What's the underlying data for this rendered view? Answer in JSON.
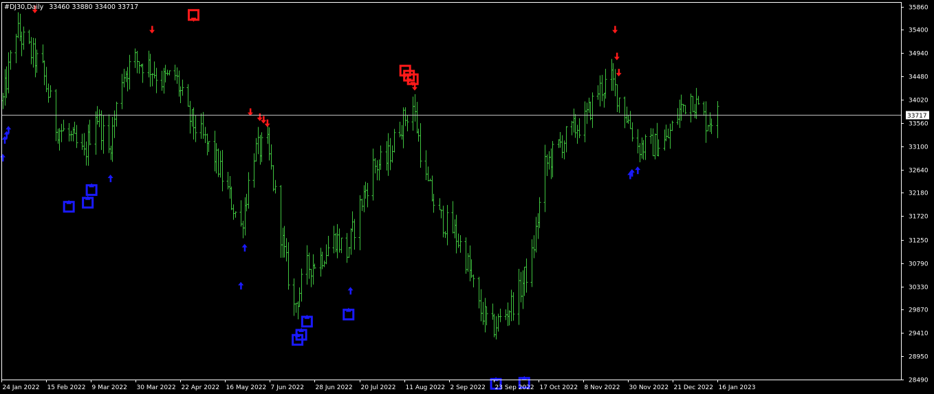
{
  "header": {
    "symbol": "#DJ30,Daily",
    "ohlc": "33460 33880 33400 33717"
  },
  "colors": {
    "background": "#000000",
    "axis": "#ffffff",
    "candle": "#3fc43f",
    "sell_marker": "#ff1a1a",
    "buy_marker": "#1a1aff",
    "price_line": "#c0c0c0"
  },
  "chart_data": {
    "type": "line",
    "title": "",
    "xlabel": "",
    "ylabel": "",
    "ylim": [
      28490,
      35950
    ],
    "y_ticks": [
      35860,
      35400,
      34940,
      34480,
      34020,
      33560,
      33100,
      32640,
      32180,
      31720,
      31250,
      30790,
      30330,
      29870,
      29410,
      28950,
      28490
    ],
    "x_tick_labels": [
      "24 Jan 2022",
      "15 Feb 2022",
      "9 Mar 2022",
      "30 Mar 2022",
      "22 Apr 2022",
      "16 May 2022",
      "7 Jun 2022",
      "28 Jun 2022",
      "20 Jul 2022",
      "11 Aug 2022",
      "2 Sep 2022",
      "23 Sep 2022",
      "17 Oct 2022",
      "8 Nov 2022",
      "30 Nov 2022",
      "21 Dec 2022",
      "16 Jan 2023"
    ],
    "current_price": 33717,
    "series": [
      {
        "name": "",
        "x": [
          "2022-01-10",
          "2022-01-17",
          "2022-01-24",
          "2022-01-31",
          "2022-02-07",
          "2022-02-14",
          "2022-02-22",
          "2022-02-28",
          "2022-03-07",
          "2022-03-14",
          "2022-03-21",
          "2022-03-28",
          "2022-04-04",
          "2022-04-11",
          "2022-04-18",
          "2022-04-25",
          "2022-05-02",
          "2022-05-09",
          "2022-05-16",
          "2022-05-23",
          "2022-05-30",
          "2022-06-06",
          "2022-06-13",
          "2022-06-20",
          "2022-06-27",
          "2022-07-05",
          "2022-07-11",
          "2022-07-18",
          "2022-07-25",
          "2022-08-01",
          "2022-08-08",
          "2022-08-15",
          "2022-08-22",
          "2022-08-29",
          "2022-09-06",
          "2022-09-12",
          "2022-09-19",
          "2022-09-26",
          "2022-10-03",
          "2022-10-10",
          "2022-10-17",
          "2022-10-24",
          "2022-10-31",
          "2022-11-07",
          "2022-11-14",
          "2022-11-21",
          "2022-11-28",
          "2022-12-05",
          "2022-12-12",
          "2022-12-19",
          "2022-12-27",
          "2023-01-03",
          "2023-01-09",
          "2023-01-17",
          "2023-01-23"
        ],
        "values": [
          34000,
          35400,
          35000,
          34600,
          33500,
          33300,
          32900,
          33800,
          33000,
          34500,
          34800,
          34700,
          34400,
          34500,
          33700,
          33300,
          32900,
          32200,
          31500,
          33000,
          33100,
          31400,
          29900,
          30700,
          30900,
          31300,
          31000,
          31900,
          32700,
          32800,
          33500,
          33900,
          32400,
          31700,
          31400,
          30900,
          29900,
          29500,
          29800,
          30200,
          30900,
          32700,
          33100,
          33400,
          33600,
          34200,
          34400,
          33800,
          33100,
          33100,
          33200,
          33800,
          34100,
          33600,
          33717
        ]
      }
    ],
    "sell_signals": [
      {
        "x": "2022-01-27",
        "value": 35730,
        "kind": "arrow"
      },
      {
        "x": "2022-03-30",
        "value": 35330,
        "kind": "arrow"
      },
      {
        "x": "2022-04-21",
        "value": 35600,
        "kind": "box"
      },
      {
        "x": "2022-05-21",
        "value": 33700,
        "kind": "arrow"
      },
      {
        "x": "2022-05-26",
        "value": 33600,
        "kind": "arrow"
      },
      {
        "x": "2022-05-28",
        "value": 33550,
        "kind": "arrow"
      },
      {
        "x": "2022-05-30",
        "value": 33480,
        "kind": "arrow"
      },
      {
        "x": "2022-08-11",
        "value": 34500,
        "kind": "box"
      },
      {
        "x": "2022-08-13",
        "value": 34400,
        "kind": "box"
      },
      {
        "x": "2022-08-15",
        "value": 34330,
        "kind": "box"
      },
      {
        "x": "2022-08-16",
        "value": 34200,
        "kind": "arrow"
      },
      {
        "x": "2022-11-30",
        "value": 35330,
        "kind": "arrow"
      },
      {
        "x": "2022-12-01",
        "value": 34800,
        "kind": "arrow"
      },
      {
        "x": "2022-12-02",
        "value": 34480,
        "kind": "arrow"
      }
    ],
    "buy_signals": [
      {
        "x": "2022-01-10",
        "value": 32950,
        "kind": "arrow"
      },
      {
        "x": "2022-01-11",
        "value": 33300,
        "kind": "arrow"
      },
      {
        "x": "2022-01-12",
        "value": 33400,
        "kind": "arrow"
      },
      {
        "x": "2022-01-13",
        "value": 33500,
        "kind": "arrow"
      },
      {
        "x": "2022-02-14",
        "value": 32000,
        "kind": "box"
      },
      {
        "x": "2022-02-24",
        "value": 32080,
        "kind": "box"
      },
      {
        "x": "2022-02-26",
        "value": 32330,
        "kind": "box"
      },
      {
        "x": "2022-03-08",
        "value": 32540,
        "kind": "arrow"
      },
      {
        "x": "2022-05-16",
        "value": 30420,
        "kind": "arrow"
      },
      {
        "x": "2022-05-18",
        "value": 31170,
        "kind": "arrow"
      },
      {
        "x": "2022-06-15",
        "value": 29370,
        "kind": "box"
      },
      {
        "x": "2022-06-17",
        "value": 29470,
        "kind": "box"
      },
      {
        "x": "2022-06-20",
        "value": 29730,
        "kind": "box"
      },
      {
        "x": "2022-07-12",
        "value": 29870,
        "kind": "box"
      },
      {
        "x": "2022-07-13",
        "value": 30320,
        "kind": "arrow"
      },
      {
        "x": "2022-09-28",
        "value": 28500,
        "kind": "box"
      },
      {
        "x": "2022-10-13",
        "value": 28520,
        "kind": "box"
      },
      {
        "x": "2022-12-08",
        "value": 32600,
        "kind": "arrow"
      },
      {
        "x": "2022-12-09",
        "value": 32650,
        "kind": "arrow"
      },
      {
        "x": "2022-12-12",
        "value": 32700,
        "kind": "arrow"
      }
    ]
  }
}
